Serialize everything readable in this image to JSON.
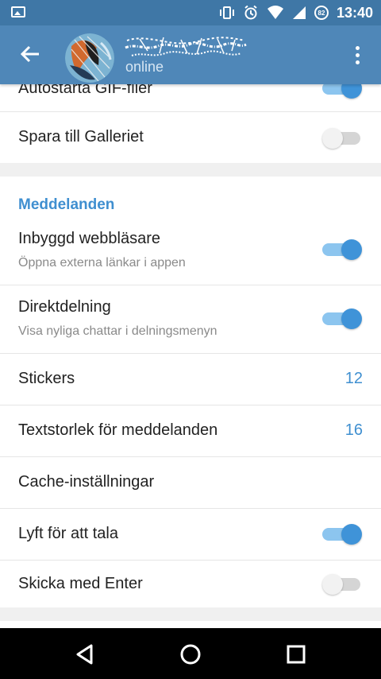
{
  "status_bar": {
    "time": "13:40",
    "battery_level": "82",
    "icons": [
      "image-icon",
      "vibrate-icon",
      "alarm-icon",
      "wifi-icon",
      "signal-icon",
      "battery-icon"
    ]
  },
  "app_bar": {
    "status": "online",
    "icons": [
      "back-arrow-icon",
      "avatar",
      "overflow-menu-icon"
    ]
  },
  "settings": {
    "partial_row": {
      "title": "Autostarta GIF-filer",
      "enabled": true
    },
    "save_gallery": {
      "title": "Spara till Galleriet",
      "enabled": false
    },
    "messages_section": {
      "header": "Meddelanden"
    },
    "in_app_browser": {
      "title": "Inbyggd webbläsare",
      "subtitle": "Öppna externa länkar i appen",
      "enabled": true
    },
    "direct_share": {
      "title": "Direktdelning",
      "subtitle": "Visa nyliga chattar i delningsmenyn",
      "enabled": true
    },
    "stickers": {
      "title": "Stickers",
      "value": "12"
    },
    "text_size": {
      "title": "Textstorlek för meddelanden",
      "value": "16"
    },
    "cache": {
      "title": "Cache-inställningar"
    },
    "raise_to_speak": {
      "title": "Lyft för att tala",
      "enabled": true
    },
    "send_by_enter": {
      "title": "Skicka med Enter",
      "enabled": false
    }
  },
  "colors": {
    "status_bar": "#3f77a6",
    "app_bar": "#4f87b8",
    "accent": "#3f8fd0",
    "toggle_on": "#3f93d8",
    "toggle_off": "#d5d5d5"
  },
  "nav_bar": {
    "icons": [
      "back-triangle-icon",
      "home-circle-icon",
      "recents-square-icon"
    ]
  }
}
